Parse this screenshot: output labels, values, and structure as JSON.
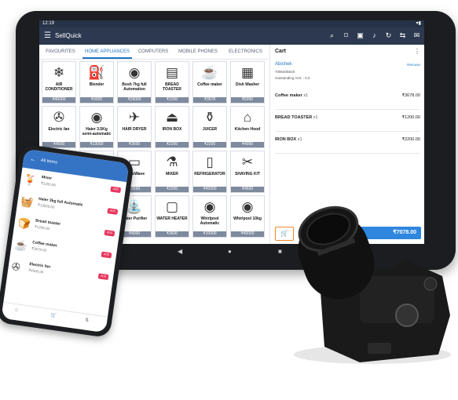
{
  "status_time": "12:19",
  "app_title": "SellQuick",
  "tabs": [
    {
      "label": "FAVOURITES",
      "active": false
    },
    {
      "label": "HOME APPLIANCES",
      "active": true
    },
    {
      "label": "COMPUTERS",
      "active": false
    },
    {
      "label": "MOBILE PHONES",
      "active": false
    },
    {
      "label": "ELECTRONICS",
      "active": false
    }
  ],
  "products": [
    {
      "name": "AIR CONDITIONER",
      "price": "₹46000",
      "icon": "air-conditioner"
    },
    {
      "name": "Blender",
      "price": "₹3000",
      "icon": "blender"
    },
    {
      "name": "Bosh 7kg full Automation",
      "price": "₹29000",
      "icon": "washing-machine"
    },
    {
      "name": "BREAD TOASTER",
      "price": "₹1200",
      "icon": "toaster"
    },
    {
      "name": "Coffee maker",
      "price": "₹3678",
      "icon": "coffee-maker"
    },
    {
      "name": "Dish Washer",
      "price": "₹5000",
      "icon": "dish-washer"
    },
    {
      "name": "Electric fan",
      "price": "₹4500",
      "icon": "fan"
    },
    {
      "name": "Haier 3.5Kg semi-automatic",
      "price": "₹13000",
      "icon": "washing-machine"
    },
    {
      "name": "HAIR DRYER",
      "price": "₹3500",
      "icon": "hair-dryer"
    },
    {
      "name": "IRON BOX",
      "price": "₹2200",
      "icon": "iron"
    },
    {
      "name": "JUICER",
      "price": "₹2200",
      "icon": "juicer"
    },
    {
      "name": "Kitchen Hood",
      "price": "₹4090",
      "icon": "kitchen-hood"
    },
    {
      "name": "",
      "price": "",
      "icon": "blank"
    },
    {
      "name": "",
      "price": "",
      "icon": "blank"
    },
    {
      "name": "MicroWave",
      "price": "₹3599",
      "icon": "microwave"
    },
    {
      "name": "MIXER",
      "price": "₹2200",
      "icon": "mixer"
    },
    {
      "name": "REFRIGERATOR",
      "price": "₹45000",
      "icon": "refrigerator"
    },
    {
      "name": "SHAVING KIT",
      "price": "₹4500",
      "icon": "shaver"
    },
    {
      "name": "",
      "price": "",
      "icon": "blank"
    },
    {
      "name": "",
      "price": "",
      "icon": "blank"
    },
    {
      "name": "Water Purifier",
      "price": "₹4000",
      "icon": "water-purifier"
    },
    {
      "name": "WATER HEATER",
      "price": "₹3600",
      "icon": "water-heater"
    },
    {
      "name": "Whirlpool Automatic",
      "price": "₹10000",
      "icon": "washing-machine"
    },
    {
      "name": "Whirlpool 10kg",
      "price": "₹40000",
      "icon": "washing-machine"
    }
  ],
  "cart": {
    "title": "Cart",
    "customer": "Abishek",
    "remove_label": "Remove",
    "phone": "7096405819",
    "outstanding": "Outstanding Amt. : 0.0",
    "items": [
      {
        "name": "Coffee maker",
        "qty": "x1",
        "price": "₹3678.00"
      },
      {
        "name": "BREAD TOASTER",
        "qty": "x1",
        "price": "₹1200.00"
      },
      {
        "name": "IRON BOX",
        "qty": "x1",
        "price": "₹2200.00"
      }
    ],
    "total": "₹7078.00"
  },
  "phone": {
    "title": "All Items",
    "items": [
      {
        "name": "Mixer",
        "price": "₹2200.00",
        "add": "ADD"
      },
      {
        "name": "Haier 3kg full Automatic",
        "price": "₹13000.00",
        "add": "ADD"
      },
      {
        "name": "Bread toaster",
        "price": "₹1200.00",
        "add": "ADD"
      },
      {
        "name": "Coffee maker",
        "price": "₹3678.00",
        "add": "ADD"
      },
      {
        "name": "Electric fan",
        "price": "₹4500.00",
        "add": "ADD"
      }
    ]
  }
}
